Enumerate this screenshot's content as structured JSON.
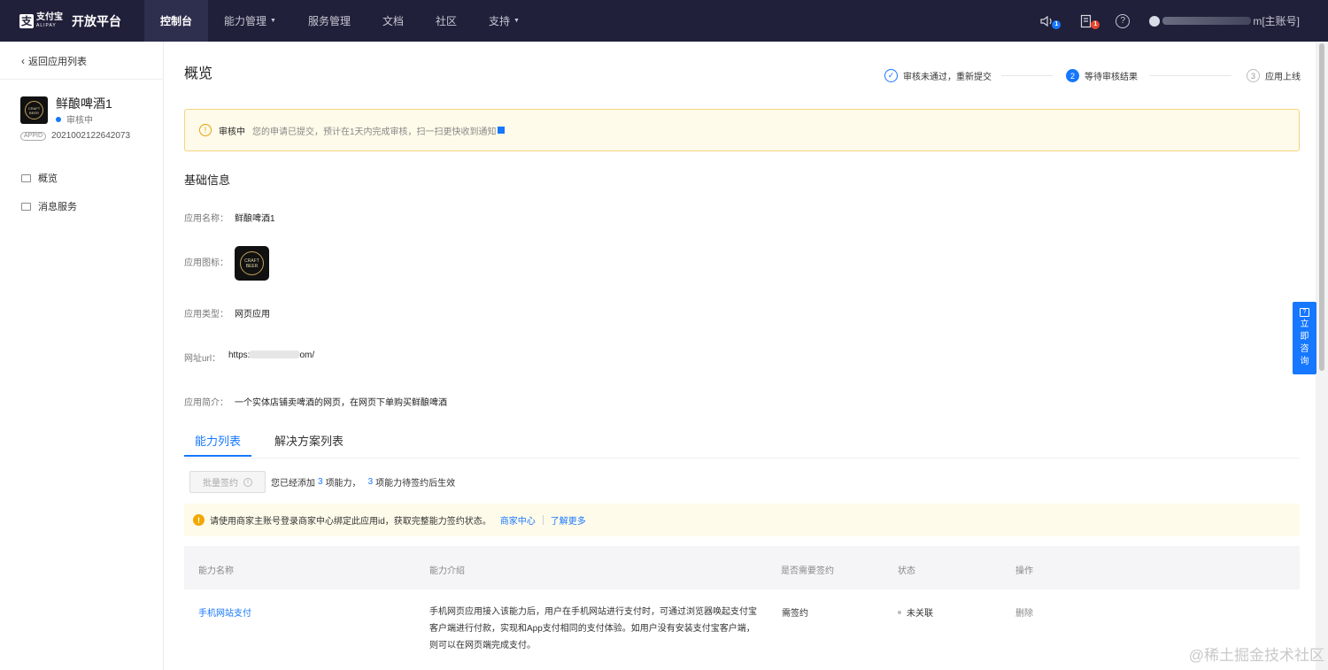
{
  "topnav": {
    "brand_cn": "支付宝",
    "brand_en": "ALIPAY",
    "brand_title": "开放平台",
    "items": [
      {
        "label": "控制台",
        "active": true,
        "caret": false
      },
      {
        "label": "能力管理",
        "active": false,
        "caret": true
      },
      {
        "label": "服务管理",
        "active": false,
        "caret": false
      },
      {
        "label": "文档",
        "active": false,
        "caret": false
      },
      {
        "label": "社区",
        "active": false,
        "caret": false
      },
      {
        "label": "支持",
        "active": false,
        "caret": true
      }
    ],
    "notice_count": "1",
    "message_count": "1",
    "account_suffix": "m[主账号]"
  },
  "sidebar": {
    "back_label": "返回应用列表",
    "app_name": "鲜酿啤酒1",
    "app_status": "审核中",
    "appid_tag": "APPID",
    "appid": "2021002122642073",
    "icon_text": "CRAFT BEER",
    "menu": [
      {
        "label": "概览"
      },
      {
        "label": "消息服务"
      }
    ]
  },
  "main": {
    "title": "概览",
    "steps": [
      {
        "index": "✓",
        "label": "审核未通过，重新提交",
        "state": "done"
      },
      {
        "index": "2",
        "label": "等待审核结果",
        "state": "active"
      },
      {
        "index": "3",
        "label": "应用上线",
        "state": "todo"
      }
    ],
    "review_alert": {
      "status": "审核中",
      "desc": "您的申请已提交，预计在1天内完成审核，扫一扫更快收到通知"
    },
    "basic_info_title": "基础信息",
    "info": {
      "name_label": "应用名称：",
      "name_value": "鲜酿啤酒1",
      "icon_label": "应用图标：",
      "type_label": "应用类型：",
      "type_value": "网页应用",
      "url_label": "网址url：",
      "url_prefix": "https:",
      "url_suffix": "om/",
      "intro_label": "应用简介：",
      "intro_value": "一个实体店铺卖啤酒的网页，在网页下单购买鲜酿啤酒"
    },
    "tabs": [
      {
        "label": "能力列表",
        "active": true
      },
      {
        "label": "解决方案列表",
        "active": false
      }
    ],
    "batch": {
      "button": "批量签约",
      "text1": "您已经添加",
      "count1": "3",
      "text2": "项能力，",
      "count2": "3",
      "text3": "项能力待签约后生效"
    },
    "tip": {
      "text": "请使用商家主账号登录商家中心绑定此应用id，获取完整能力签约状态。",
      "link1": "商家中心",
      "link2": "了解更多"
    },
    "table": {
      "headers": [
        "能力名称",
        "能力介绍",
        "是否需要签约",
        "状态",
        "操作"
      ],
      "rows": [
        {
          "name": "手机网站支付",
          "desc": "手机网页应用接入该能力后，用户在手机网站进行支付时，可通过浏览器唤起支付宝客户端进行付款，实现和App支付相同的支付体验。如用户没有安装支付宝客户端，则可以在网页端完成支付。",
          "sign": "需签约",
          "status": "未关联",
          "op": "删除"
        }
      ]
    }
  },
  "consult": {
    "label": [
      "立",
      "即",
      "咨",
      "询"
    ]
  },
  "watermark": "@稀土掘金技术社区",
  "colors": {
    "nav_bg": "#20203a",
    "accent": "#1677ff",
    "warning": "#f0a800"
  }
}
